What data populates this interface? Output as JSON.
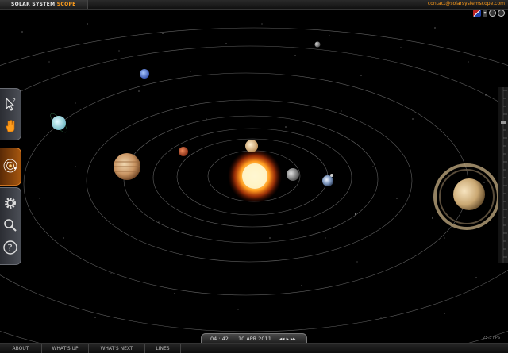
{
  "header": {
    "brand_part1": "SOLAR SYSTEM",
    "brand_part2": "SCOPE",
    "contact": "contact@solarsystemscope.com"
  },
  "toolbar": {
    "select_tool_icon": "cursor-question-icon",
    "pan_tool_icon": "hand-icon",
    "view_icon": "solar-system-view-icon",
    "settings_icon": "gear-icon",
    "search_icon": "magnifier-icon",
    "help_icon": "help-icon"
  },
  "time": {
    "clock": "04 : 42",
    "date": "10 APR 2011",
    "controls": "◂◂  ▸  ▸▸"
  },
  "fps": "25.3 FPS",
  "bottom_nav": [
    "ABOUT",
    "WHAT'S UP",
    "WHAT'S NEXT",
    "LINES"
  ],
  "colors": {
    "accent": "#ff9d1c",
    "background": "#000000",
    "orbit": "#8a8a8a"
  }
}
